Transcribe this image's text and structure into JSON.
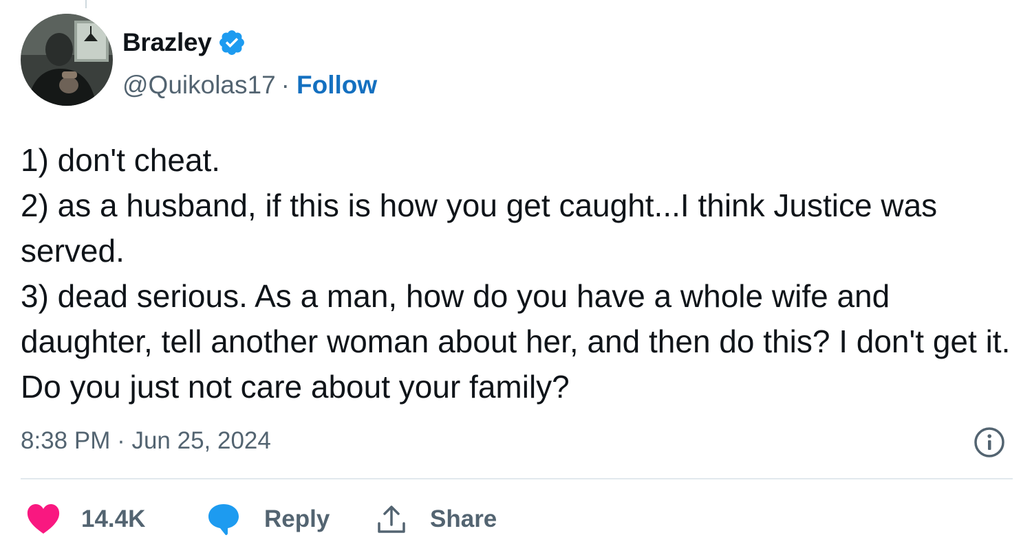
{
  "colors": {
    "text_primary": "#0f1419",
    "text_secondary": "#536471",
    "follow_blue": "#1470c0",
    "verified_blue": "#1d9bf0",
    "like_pink": "#f91880",
    "reply_blue": "#1d9bf0",
    "divider": "#e1e8ed"
  },
  "author": {
    "display_name": "Brazley",
    "handle": "@Quikolas17",
    "separator": "·",
    "follow_label": "Follow",
    "verified": true,
    "avatar_icon": "profile-photo-avatar"
  },
  "tweet": {
    "text": "1) don't cheat.\n2) as a husband, if this is how you get caught...I think Justice was served.\n3) dead serious. As a man, how do you have a whole wife and daughter, tell another woman about her, and then do this? I don't get it. Do you just not care about your family?",
    "time": "8:38 PM",
    "date_separator": " · ",
    "date": "Jun 25, 2024"
  },
  "actions": {
    "like_count": "14.4K",
    "reply_label": "Reply",
    "share_label": "Share",
    "icons": [
      "heart-icon",
      "reply-bubble-icon",
      "share-upload-icon",
      "info-icon"
    ]
  }
}
